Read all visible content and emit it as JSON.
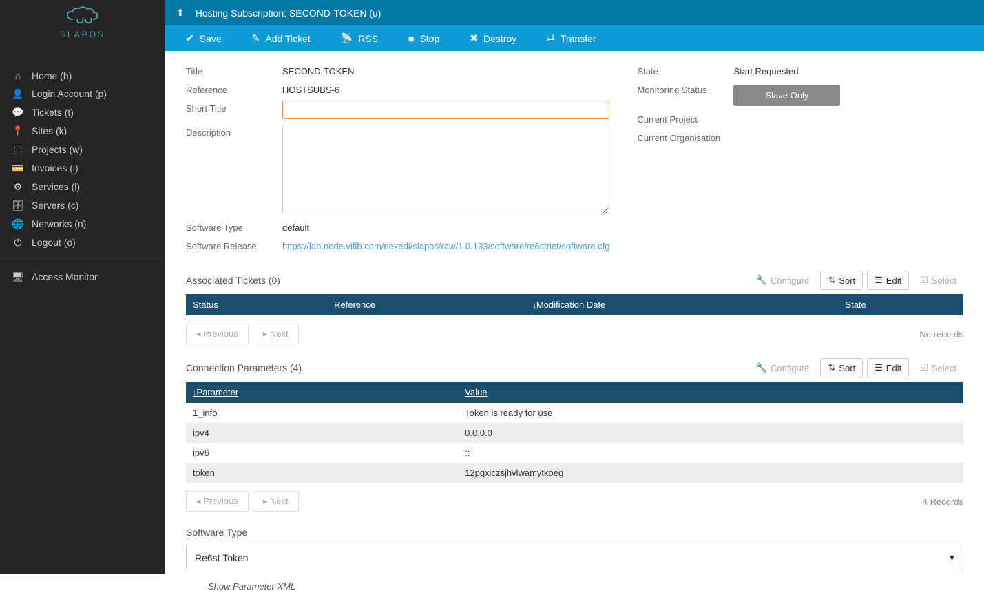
{
  "logo": {
    "text": "SLAPOS"
  },
  "sidebar": {
    "items": [
      {
        "label": "Home (h)",
        "icon": "home"
      },
      {
        "label": "Login Account (p)",
        "icon": "user"
      },
      {
        "label": "Tickets (t)",
        "icon": "chat"
      },
      {
        "label": "Sites (k)",
        "icon": "marker"
      },
      {
        "label": "Projects (w)",
        "icon": "cubes"
      },
      {
        "label": "Invoices (i)",
        "icon": "card"
      },
      {
        "label": "Services (l)",
        "icon": "cog"
      },
      {
        "label": "Servers (c)",
        "icon": "db"
      },
      {
        "label": "Networks (n)",
        "icon": "globe"
      },
      {
        "label": "Logout (o)",
        "icon": "power"
      }
    ],
    "monitor": {
      "label": "Access Monitor",
      "icon": "desktop"
    }
  },
  "header": {
    "title": "Hosting Subscription: SECOND-TOKEN (u)"
  },
  "toolbar": {
    "save": "Save",
    "add_ticket": "Add Ticket",
    "rss": "RSS",
    "stop": "Stop",
    "destroy": "Destroy",
    "transfer": "Transfer"
  },
  "form": {
    "title_label": "Title",
    "title_value": "SECOND-TOKEN",
    "reference_label": "Reference",
    "reference_value": "HOSTSUBS-6",
    "short_title_label": "Short Title",
    "short_title_value": "",
    "description_label": "Description",
    "description_value": "",
    "software_type_label": "Software Type",
    "software_type_value": "default",
    "software_release_label": "Software Release",
    "software_release_value": "https://lab.node.vifib.com/nexedi/slapos/raw/1.0.133/software/re6stnet/software.cfg",
    "state_label": "State",
    "state_value": "Start Requested",
    "monitoring_label": "Monitoring Status",
    "monitoring_value": "Slave Only",
    "current_project_label": "Current Project",
    "current_org_label": "Current Organisation"
  },
  "tickets": {
    "title": "Associated Tickets (0)",
    "cols": {
      "status": "Status",
      "reference": "Reference",
      "moddate": "Modification Date",
      "state": "State"
    },
    "no_records": "No records",
    "prev": "Previous",
    "next": "Next"
  },
  "params": {
    "title": "Connection Parameters (4)",
    "cols": {
      "param": "Parameter",
      "value": "Value"
    },
    "rows": [
      {
        "p": "1_info",
        "v": "Token is ready for use"
      },
      {
        "p": "ipv4",
        "v": "0.0.0.0"
      },
      {
        "p": "ipv6",
        "v": "::"
      },
      {
        "p": "token",
        "v": "12pqxiczsjhvlwamytkoeg"
      }
    ],
    "count": "4 Records",
    "prev": "Previous",
    "next": "Next"
  },
  "actions": {
    "configure": "Configure",
    "sort": "Sort",
    "edit": "Edit",
    "select": "Select"
  },
  "soft_type": {
    "label": "Software Type",
    "value": "Re6st Token"
  },
  "param_xml": "Show Parameter XML"
}
